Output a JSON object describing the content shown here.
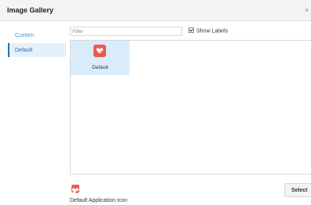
{
  "dialog": {
    "title": "Image Gallery",
    "close_glyph": "×",
    "close_icon": "close-icon"
  },
  "sidebar": {
    "items": [
      {
        "label": "Custom",
        "selected": false
      },
      {
        "label": "Default",
        "selected": true
      }
    ]
  },
  "filter": {
    "placeholder": "Filter",
    "value": ""
  },
  "show_labels": {
    "label": "Show Labels",
    "checked": true
  },
  "gallery": {
    "items": [
      {
        "label": "Default",
        "icon": "heart-gear-icon",
        "selected": true
      }
    ]
  },
  "preview": {
    "label": "Default Application Icon",
    "icon": "heart-gear-icon"
  },
  "actions": {
    "select_label": "Select"
  },
  "colors": {
    "accent": "#3b8fd5",
    "icon_red": "#e85b51",
    "selection_bg": "#d9ecfb"
  }
}
